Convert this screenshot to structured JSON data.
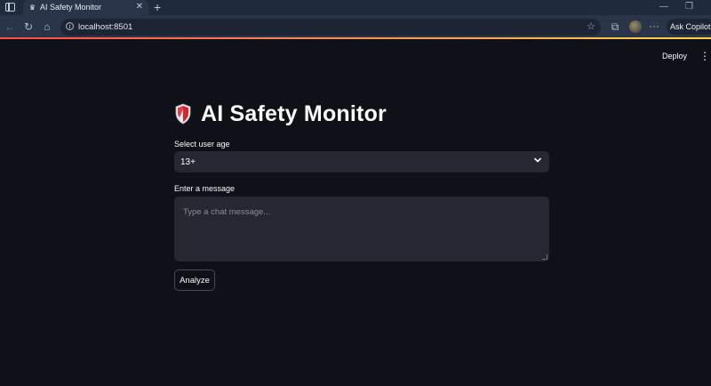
{
  "browser": {
    "tab_title": "AI Safety Monitor",
    "tab_close": "✕",
    "new_tab": "+",
    "url": "localhost:8501",
    "copilot_label": "Ask Copilot",
    "minimize": "—",
    "restore": "❐"
  },
  "app": {
    "deploy_label": "Deploy",
    "menu_icon": "⋮",
    "title": "AI Safety Monitor",
    "age_label": "Select user age",
    "age_value": "13+",
    "message_label": "Enter a message",
    "message_placeholder": "Type a chat message...",
    "analyze_label": "Analyze",
    "accent_color": "#ff4b4b"
  },
  "icons": {
    "shield": "shield-icon",
    "chevron": "chevron-down-icon",
    "info": "info-icon",
    "star": "star-icon"
  }
}
